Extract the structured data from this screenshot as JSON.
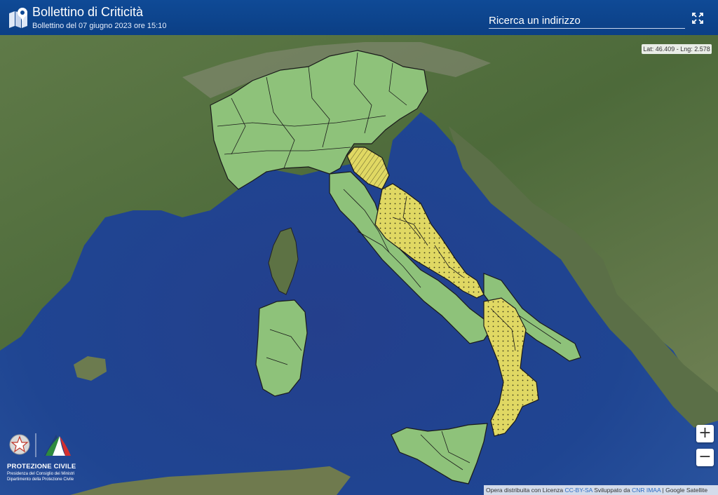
{
  "header": {
    "title": "Bollettino di Criticità",
    "subtitle": "Bollettino del 07 giugno 2023 ore 15:10",
    "search_placeholder": "Ricerca un indirizzo",
    "logo_icon": "map-marker-icon",
    "fullscreen_icon": "fullscreen-icon"
  },
  "coords": "Lat: 46.409 - Lng: 2.578",
  "zoom": {
    "in": "+",
    "out": "−"
  },
  "attribution": {
    "pre": "Opera distribuita con Licenza ",
    "license": "CC-BY-SA",
    "mid": " Sviluppato da ",
    "dev": "CNR IMAA",
    "post": " | Google Satellite"
  },
  "logo": {
    "name": "PROTEZIONE CIVILE",
    "sub1": "Presidenza del Consiglio dei Ministri",
    "sub2": "Dipartimento della Protezione Civile"
  },
  "legend_colors": {
    "green": "#8ec27a",
    "yellow": "#e0d863",
    "sea": "#1e478f",
    "header": "#0f4a96"
  }
}
